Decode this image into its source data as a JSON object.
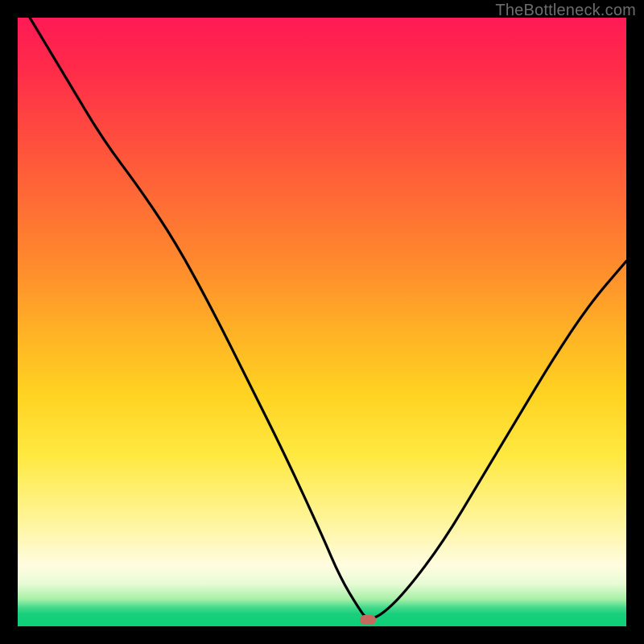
{
  "watermark": "TheBottleneck.com",
  "chart_data": {
    "type": "line",
    "title": "",
    "xlabel": "",
    "ylabel": "",
    "xlim": [
      0,
      100
    ],
    "ylim": [
      0,
      100
    ],
    "series": [
      {
        "name": "bottleneck-curve",
        "x": [
          2,
          8,
          14,
          20,
          26,
          32,
          38,
          44,
          50,
          53,
          56,
          57.5,
          60,
          64,
          70,
          76,
          82,
          88,
          94,
          100
        ],
        "y": [
          100,
          90,
          80,
          72,
          63,
          52,
          40,
          28,
          15,
          8,
          3,
          1,
          2,
          6,
          14,
          24,
          34,
          44,
          53,
          60
        ]
      }
    ],
    "annotations": [
      {
        "name": "min-marker",
        "x": 57.5,
        "y": 1
      }
    ],
    "grid": false,
    "legend": null
  },
  "colors": {
    "curve": "#000000",
    "marker": "#c66a5f",
    "frame": "#000000"
  }
}
